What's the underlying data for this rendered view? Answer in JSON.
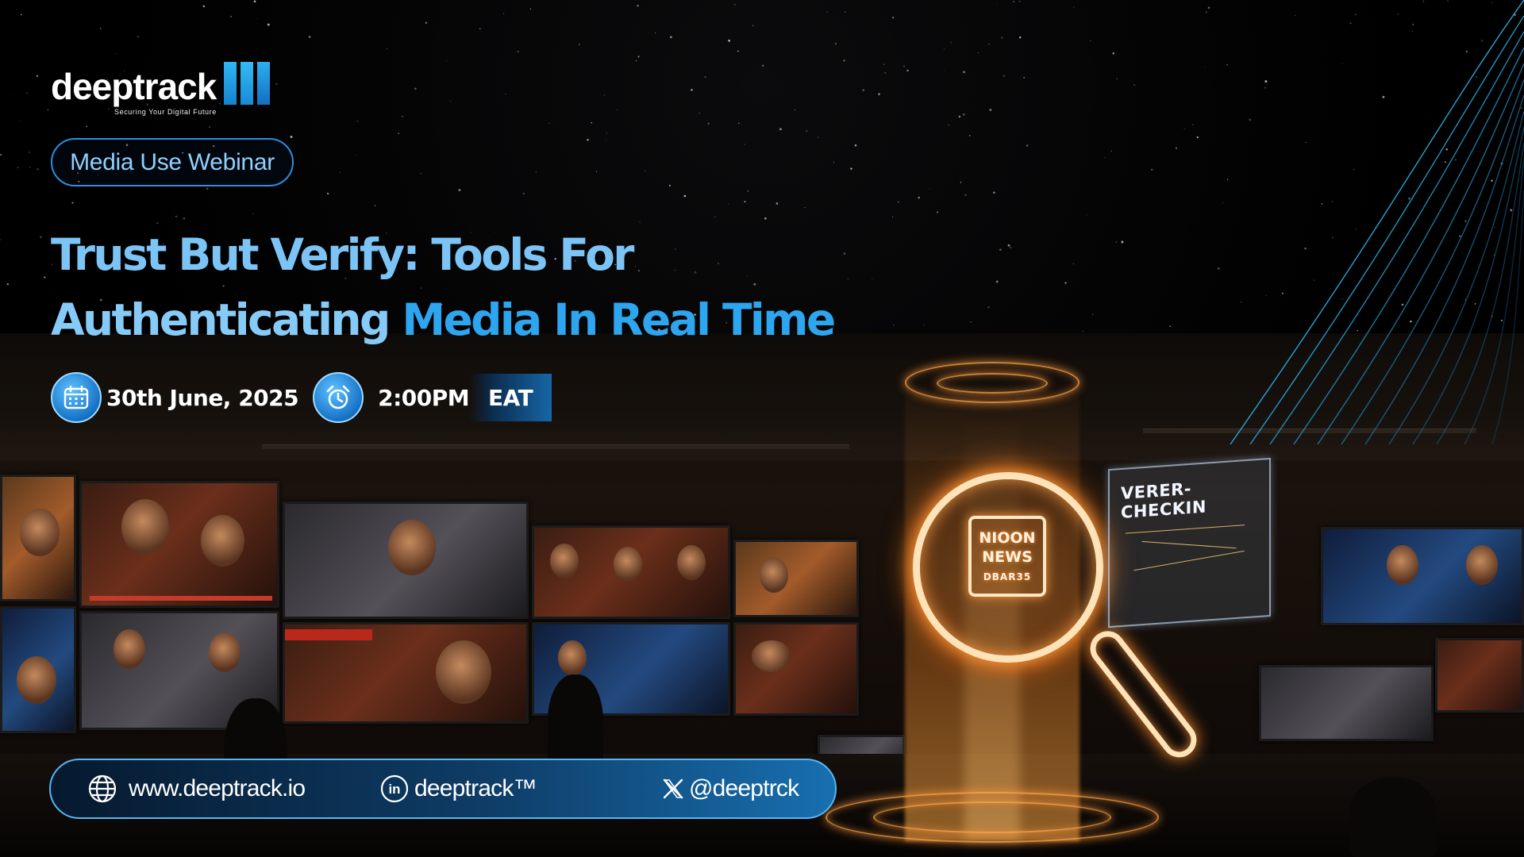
{
  "brand": {
    "name": "deeptrack",
    "tagline": "Securing Your Digital Future"
  },
  "event": {
    "type": "Media Use Webinar",
    "title_line1": "Trust But Verify: Tools For",
    "title_line2_a": "Authenticating",
    "title_line2_b": "Media In Real Time",
    "date": "30th June, 2025",
    "time": "2:00PM",
    "timezone": "EAT"
  },
  "hologram": {
    "badge_line1": "NIOON",
    "badge_line2": "NEWS",
    "badge_line3": "DBAR35",
    "panel_title": "VERER-CHECKIN"
  },
  "contacts": {
    "website": "www.deeptrack.io",
    "linkedin": "deeptrack™",
    "x_handle": "@deeptrck"
  },
  "icons": {
    "date": "calendar-icon",
    "time": "alarm-clock-icon",
    "website": "globe-icon",
    "linkedin": "linkedin-icon",
    "x": "x-logo-icon"
  },
  "colors": {
    "accent": "#2ea5ef",
    "accent_light": "#7cc4f6",
    "pill_border": "#2a8fe0",
    "hologram_glow": "#ff9a3c"
  }
}
